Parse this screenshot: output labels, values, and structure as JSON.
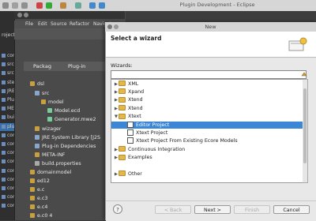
{
  "background_window": {
    "title": "Plugin Development - Eclipse",
    "menu": [
      "File",
      "Edit",
      "Source",
      "Refactor",
      "Navigate"
    ],
    "tabs": [
      "Packag",
      "Plug-in"
    ],
    "project_label": "roject Du",
    "left_items": [
      "com",
      "src",
      "src",
      "sten",
      "JRE",
      "Plug",
      "MET",
      "buil",
      "plug",
      "com",
      "com",
      "com",
      "com",
      "com",
      "com",
      "com",
      "com",
      "com"
    ],
    "tree": [
      "dsl",
      "src",
      "model",
      "Model.ecd",
      "Generator.mwe2",
      "wizager",
      "JRE System Library [J2S",
      "Plug-in Dependencies",
      "META-INF",
      "build.properties",
      "domainmodel",
      "ed12",
      "e.c",
      "e.c3",
      "e.c4",
      "e.c0 4"
    ]
  },
  "dialog": {
    "title": "New",
    "heading": "Select a wizard",
    "wizards_label": "Wizards:",
    "filter_value": "",
    "items": [
      {
        "label": "XML",
        "expand": "▶",
        "kind": "folder",
        "selected": false
      },
      {
        "label": "Xpand",
        "expand": "▶",
        "kind": "folder",
        "selected": false
      },
      {
        "label": "Xtend",
        "expand": "▶",
        "kind": "folder",
        "selected": false
      },
      {
        "label": "Xtend",
        "expand": "▶",
        "kind": "folder",
        "selected": false
      },
      {
        "label": "Xtext",
        "expand": "▼",
        "kind": "folder",
        "selected": false
      },
      {
        "label": "Editor Project",
        "expand": "",
        "kind": "item",
        "selected": true
      },
      {
        "label": "Xtext Project",
        "expand": "",
        "kind": "item",
        "selected": false
      },
      {
        "label": "Xtext Project From Existing Ecore Models",
        "expand": "",
        "kind": "item",
        "selected": false
      },
      {
        "label": "Continuous Integration",
        "expand": "▶",
        "kind": "folder",
        "selected": false
      },
      {
        "label": "Examples",
        "expand": "▶",
        "kind": "folder",
        "selected": false
      },
      {
        "label": "",
        "expand": "",
        "kind": "blank",
        "selected": false
      },
      {
        "label": "Other",
        "expand": "▶",
        "kind": "folder",
        "selected": false
      }
    ],
    "buttons": {
      "help": "?",
      "back": "< Back",
      "next": "Next >",
      "finish": "Finish",
      "cancel": "Cancel"
    }
  },
  "colors": {
    "selection": "#3b87d6",
    "folder": "#e2b74c"
  }
}
